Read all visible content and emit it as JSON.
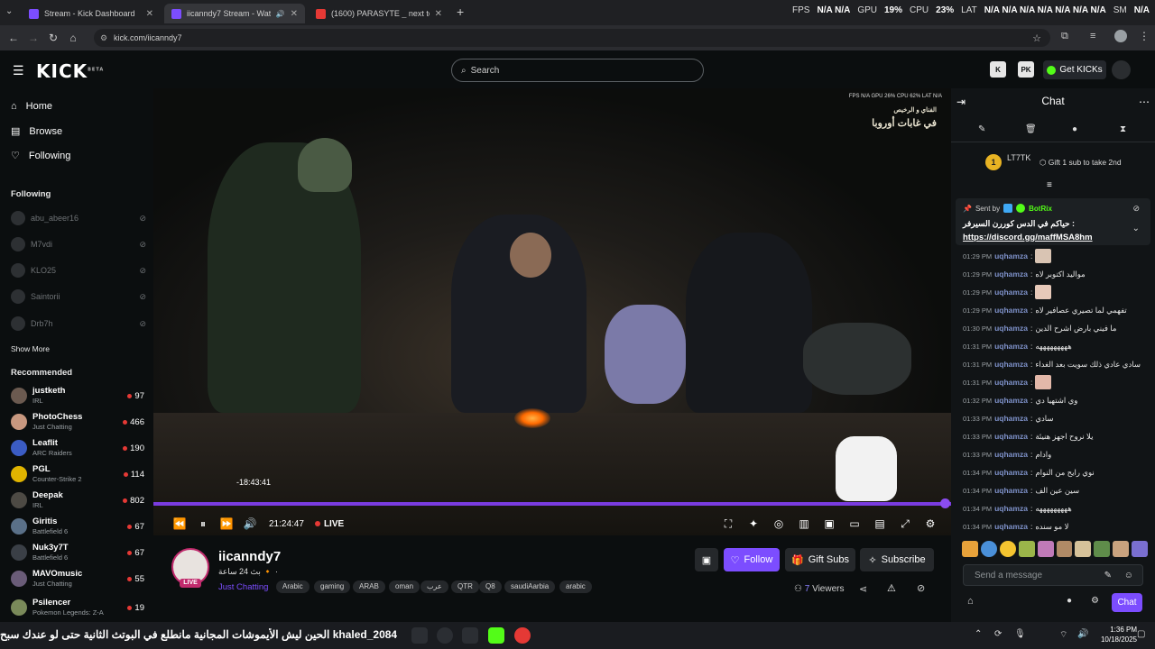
{
  "browser": {
    "tabs": [
      {
        "title": "Stream - Kick Dashboard"
      },
      {
        "title": "iicanndy7 Stream - Watch L"
      },
      {
        "title": "(1600) PARASYTE _ next to you"
      }
    ],
    "url": "kick.com/iicanndy7"
  },
  "hud": {
    "fps_label": "FPS",
    "fps": "N/A N/A",
    "gpu_label": "GPU",
    "gpu": "19%",
    "cpu_label": "CPU",
    "cpu": "23%",
    "lat_label": "LAT",
    "lat": "N/A N/A N/A N/A N/A N/A N/A",
    "sm_label": "SM",
    "sm": "N/A"
  },
  "header": {
    "logo": "KICK",
    "logo_sup": "BETA",
    "search_placeholder": "Search",
    "get_kicks": "Get KICKs"
  },
  "sidebar": {
    "nav": [
      {
        "label": "Home"
      },
      {
        "label": "Browse"
      },
      {
        "label": "Following"
      }
    ],
    "following_heading": "Following",
    "following": [
      {
        "name": "abu_abeer16"
      },
      {
        "name": "M7vdi"
      },
      {
        "name": "KLO25"
      },
      {
        "name": "Saintorii"
      },
      {
        "name": "Drb7h"
      }
    ],
    "show_more": "Show More",
    "recommended_heading": "Recommended",
    "recommended": [
      {
        "name": "justketh",
        "category": "IRL",
        "viewers": "97"
      },
      {
        "name": "PhotoChess",
        "category": "Just Chatting",
        "viewers": "466"
      },
      {
        "name": "Leaflit",
        "category": "ARC Raiders",
        "viewers": "190"
      },
      {
        "name": "PGL",
        "category": "Counter-Strike 2",
        "viewers": "114"
      },
      {
        "name": "Deepak",
        "category": "IRL",
        "viewers": "802"
      },
      {
        "name": "Giritis",
        "category": "Battlefield 6",
        "viewers": "67"
      },
      {
        "name": "Nuk3y7T",
        "category": "Battlefield 6",
        "viewers": "67"
      },
      {
        "name": "MAVOmusic",
        "category": "Just Chatting",
        "viewers": "55"
      },
      {
        "name": "Psilencer",
        "category": "Pokemon Legends: Z-A",
        "viewers": "19"
      }
    ]
  },
  "player": {
    "watermark_top": "FPS N/A  GPU 26%  CPU 62%  LAT N/A",
    "watermark_title": "الفناي و الرخيص",
    "watermark_logo": "في غابات أوروبا",
    "scrub_tooltip": "-18:43:41",
    "time": "21:24:47",
    "live_label": "LIVE",
    "progress": 1.0
  },
  "channel": {
    "name": "iicanndy7",
    "live_badge": "LIVE",
    "subtitle": "بث 24 ساعة 🔸 ·",
    "category": "Just Chatting",
    "tags": [
      "Arabic",
      "gaming",
      "ARAB",
      "oman",
      "عرب",
      "QTR",
      "Q8",
      "saudiAarbia",
      "arabic"
    ],
    "follow": "Follow",
    "gift_subs": "Gift Subs",
    "subscribe": "Subscribe",
    "viewers_count": "7",
    "viewers_label": "Viewers"
  },
  "chat": {
    "title": "Chat",
    "top_gifter": {
      "name": "LT7TK",
      "rank": "1",
      "prompt": "Gift 1 sub to take 2nd"
    },
    "pinned": {
      "sent_by": "Sent by",
      "bot": "BotRix",
      "text": "حياكم في الدس كوررن السيرفر :",
      "link": "https://discord.gg/maffMSA8hm"
    },
    "messages": [
      {
        "time": "01:29 PM",
        "user": "uqhamza",
        "text": ""
      },
      {
        "time": "01:29 PM",
        "user": "uqhamza",
        "text": "مواليد اكتوبر لاه"
      },
      {
        "time": "01:29 PM",
        "user": "uqhamza",
        "text": ""
      },
      {
        "time": "01:29 PM",
        "user": "uqhamza",
        "text": "تفهمي لما تصيري عصافير لاه"
      },
      {
        "time": "01:30 PM",
        "user": "uqhamza",
        "text": "ما فيني بارض اشرح الدين"
      },
      {
        "time": "01:31 PM",
        "user": "uqhamza",
        "text": "هههههههههه"
      },
      {
        "time": "01:31 PM",
        "user": "uqhamza",
        "text": "سادي عادي ذلك سويت بعد الغداء"
      },
      {
        "time": "01:31 PM",
        "user": "uqhamza",
        "text": ""
      },
      {
        "time": "01:32 PM",
        "user": "uqhamza",
        "text": "وي اشتهيا دي"
      },
      {
        "time": "01:33 PM",
        "user": "uqhamza",
        "text": "سادي"
      },
      {
        "time": "01:33 PM",
        "user": "uqhamza",
        "text": "يلا نروح اجهز هنيئة"
      },
      {
        "time": "01:33 PM",
        "user": "uqhamza",
        "text": "وادام"
      },
      {
        "time": "01:34 PM",
        "user": "uqhamza",
        "text": "نوي رايح من النوام"
      },
      {
        "time": "01:34 PM",
        "user": "uqhamza",
        "text": "سين عين الف"
      },
      {
        "time": "01:34 PM",
        "user": "uqhamza",
        "text": "هههههههههه"
      },
      {
        "time": "01:34 PM",
        "user": "uqhamza",
        "text": "لا مو سنده"
      }
    ],
    "input_placeholder": "Send a message",
    "send": "Chat"
  },
  "taskbar": {
    "ticker": "الحين ليش الأيموشات المجانية مانطلع في البوتث الثانية حتى لو عندك سبح khaled_2084",
    "time": "1:36 PM",
    "date": "10/18/2025"
  },
  "colors": {
    "accent": "#7c4dff",
    "kick_green": "#53fc18",
    "live_red": "#e53935",
    "bg": "#0b0e0f"
  }
}
